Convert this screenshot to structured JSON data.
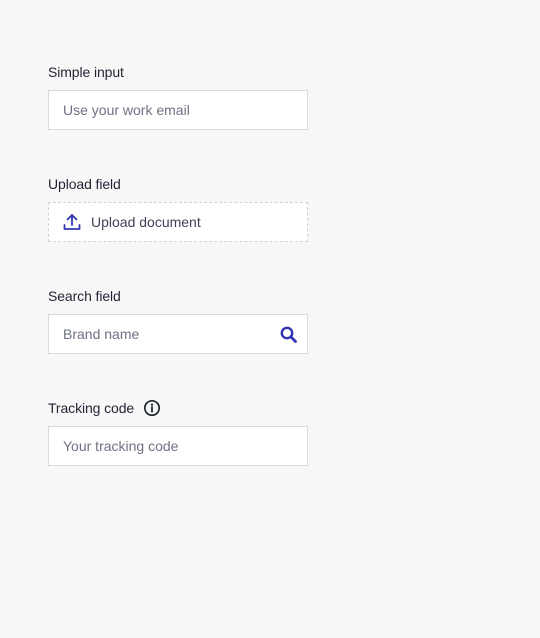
{
  "simple_input": {
    "label": "Simple input",
    "placeholder": "Use your work email"
  },
  "upload_field": {
    "label": "Upload field",
    "button_label": "Upload document",
    "icon": "upload-icon"
  },
  "search_field": {
    "label": "Search field",
    "placeholder": "Brand name",
    "icon": "search-icon"
  },
  "tracking_code": {
    "label": "Tracking code",
    "placeholder": "Your tracking code",
    "icon": "info-icon"
  },
  "colors": {
    "accent": "#2f35b5",
    "background": "#f7f7f8",
    "border": "#d8dae0"
  }
}
